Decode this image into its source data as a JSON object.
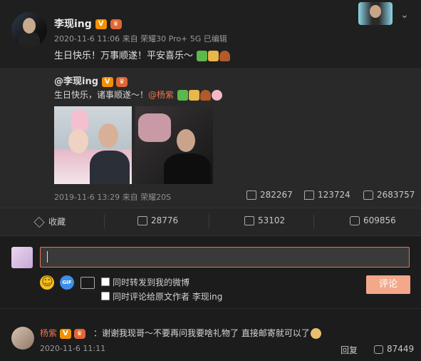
{
  "post": {
    "author": "李现ing",
    "meta": "2020-11-6 11:06 来自 荣耀30 Pro+ 5G  已编辑",
    "text": "生日快乐！万事顺遂！平安喜乐～"
  },
  "quoted": {
    "author": "@李现ing",
    "text_prefix": "生日快乐，诸事顺遂～！",
    "mention": "@杨紫",
    "meta": "2019-11-6 13:29 来自 荣耀20S",
    "shares": "282267",
    "comments": "123724",
    "likes": "2683757"
  },
  "actions": {
    "favorite": "收藏",
    "shares": "28776",
    "comments": "53102",
    "likes": "609856"
  },
  "composer": {
    "input_value": "",
    "gif_label": "GIF",
    "repost_label": "同时转发到我的微博",
    "comment_origin_label": "同时评论给原文作者 李现ing",
    "submit_label": "评论"
  },
  "comments": [
    {
      "author": "杨紫",
      "text": "：谢谢我现哥～不要再问我要啥礼物了 直接邮寄就可以了",
      "meta": "2020-11-6 11:11",
      "reply_label": "回复",
      "likes": "87449"
    }
  ],
  "colors": {
    "accent": "#eb7350",
    "button": "#f4a88a",
    "background": "#1f1f1f"
  }
}
